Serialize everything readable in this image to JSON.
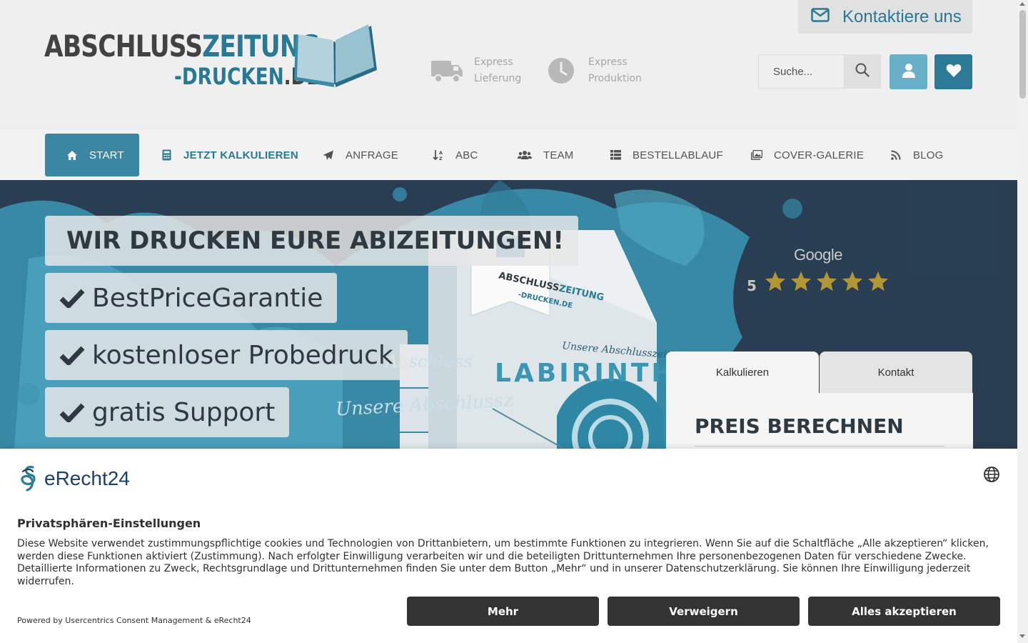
{
  "header": {
    "logo": {
      "line1_a": "ABSCHLUSS",
      "line1_b": "ZEITUNG",
      "line2_a": "-DRUCKEN",
      "line2_b": ".DE"
    },
    "features": [
      {
        "icon": "truck-icon",
        "line1": "Express",
        "line2": "Lieferung"
      },
      {
        "icon": "clock-icon",
        "line1": "Express",
        "line2": "Produktion"
      }
    ],
    "contact_label": "Kontaktiere uns",
    "search_placeholder": "Suche...",
    "accent": "#2a7c97"
  },
  "nav": {
    "items": [
      {
        "label": "START",
        "icon": "home-icon"
      },
      {
        "label": "JETZT KALKULIEREN",
        "icon": "calculator-icon"
      },
      {
        "label": "ANFRAGE",
        "icon": "paper-plane-icon"
      },
      {
        "label": "ABC",
        "icon": "sort-alpha-icon"
      },
      {
        "label": "TEAM",
        "icon": "users-icon"
      },
      {
        "label": "BESTELLABLAUF",
        "icon": "list-icon"
      },
      {
        "label": "COVER-GALERIE",
        "icon": "images-icon"
      },
      {
        "label": "BLOG",
        "icon": "rss-icon"
      }
    ]
  },
  "hero": {
    "headline": "WIR DRUCKEN EURE ABIZEITUNGEN!",
    "usps": [
      "BestPriceGarantie",
      "kostenloser Probedruck",
      "gratis Support"
    ],
    "book": {
      "brand_a": "ABSCHLUSS",
      "brand_b": "ZEITUNG",
      "brand_c": "-DRUCKEN.DE",
      "subtitle": "Unsere Abschlusszeitung",
      "title": "LABIRINTH",
      "spine_text": "Unsere Abschlussz",
      "side_text": "Abschluss"
    },
    "google": {
      "logo": "Google",
      "score": "5",
      "stars": 5
    },
    "tabs": [
      "Kalkulieren",
      "Kontakt"
    ],
    "calc_title": "PREIS BERECHNEN"
  },
  "consent": {
    "brand": "eRecht24",
    "title": "Privatsphären-Einstellungen",
    "body": "Diese Website verwendet zustimmungspflichtige cookies und Technologien von Drittanbietern, um bestimmte Funktionen zu integrieren. Wenn Sie auf die Schaltfläche „Alle akzeptieren“ klicken, werden diese Funktionen aktiviert (Zustimmung). Nach erfolgter Einwilligung verarbeiten wir und die beteiligten Drittunternehmen Ihre personenbezogenen Daten für verschiedene Zwecke. Detaillierte Informationen zu Zweck, Rechtsgrundlage und Drittunternehmen finden Sie unter dem Button „Mehr“ und in unserer Datenschutzerklärung. Sie können Ihre Einwilligung jederzeit widerrufen.",
    "powered_by": "Powered by Usercentrics Consent Management & eRecht24",
    "buttons": {
      "more": "Mehr",
      "deny": "Verweigern",
      "accept_all": "Alles akzeptieren"
    }
  }
}
